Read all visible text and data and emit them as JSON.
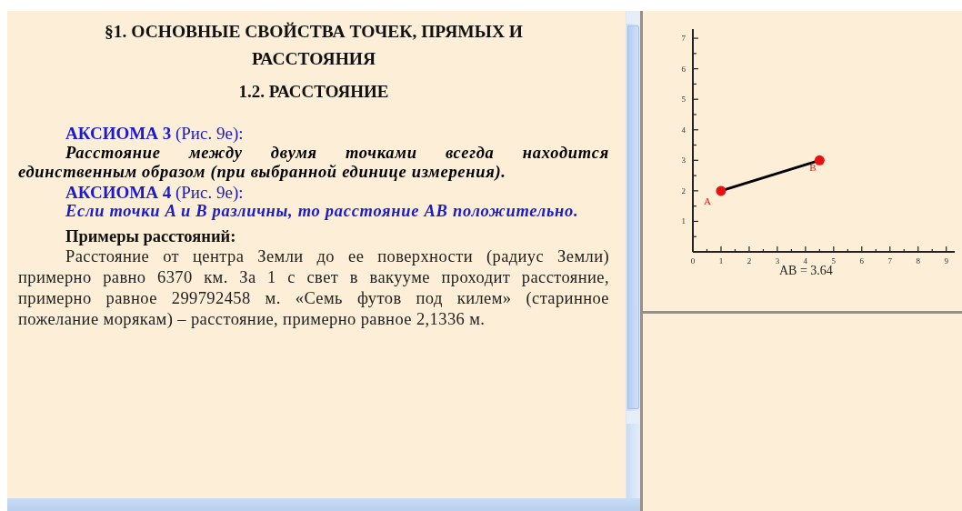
{
  "lesson": {
    "heading": "§1. ОСНОВНЫЕ СВОЙСТВА ТОЧЕК, ПРЯМЫХ И РАССТОЯНИЯ",
    "subheading": "1.2. РАССТОЯНИЕ",
    "blocks": [
      {
        "kind": "axiom",
        "title": "АКСИОМА 3",
        "ref": "(Рис. 9е):"
      },
      {
        "kind": "statement",
        "color": "#000000",
        "text": "Расстояние между двумя точками всегда находится единственным образом (при выбранной единице измерения)."
      },
      {
        "kind": "axiom",
        "title": "АКСИОМА 4",
        "ref": "(Рис. 9е):"
      },
      {
        "kind": "statement",
        "color": "#1a1ad0",
        "text": "Если точки A и B различны, то расстояние AB положительно."
      },
      {
        "kind": "subtitle",
        "text": "Примеры расстояний:"
      },
      {
        "kind": "paragraph",
        "text": "Расстояние от центра Земли до ее поверхности (радиус Земли) примерно равно 6370 км. За 1 с свет в вакууме проходит расстояние, примерно равное 299792458 м. «Семь футов под килем» (старинное пожелание морякам) – расстояние, примерно равное 2,1336 м."
      }
    ]
  },
  "figure": {
    "chart_data": {
      "type": "line",
      "x": [
        1,
        4.5
      ],
      "series": [
        {
          "color": "#000000",
          "marker": "circle",
          "values": [
            2,
            3
          ]
        }
      ],
      "xlim": [
        0,
        9.3
      ],
      "ylim": [
        0,
        7.3
      ],
      "xticks": [
        0,
        1,
        2,
        3,
        4,
        5,
        6,
        7,
        8,
        9
      ],
      "yticks": [
        1,
        2,
        3,
        4,
        5,
        6,
        7
      ],
      "annotations": [
        {
          "text": "A",
          "x": 1,
          "y": 2
        },
        {
          "text": "B",
          "x": 4.5,
          "y": 3
        }
      ]
    },
    "caption": "AB = 3.64"
  }
}
